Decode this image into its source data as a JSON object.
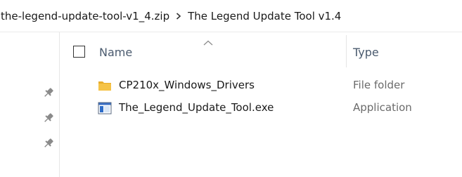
{
  "breadcrumb": {
    "items": [
      "the-legend-update-tool-v1_4.zip",
      "The Legend Update Tool v1.4"
    ],
    "separator_icon": "chevron-right-icon"
  },
  "nav_pane": {
    "pins": [
      "pin-icon",
      "pin-icon",
      "pin-icon"
    ]
  },
  "columns": {
    "name": "Name",
    "type": "Type",
    "sort_indicator": "sort-ascending-icon"
  },
  "files": [
    {
      "name": "CP210x_Windows_Drivers",
      "type": "File folder",
      "icon": "folder-icon"
    },
    {
      "name": "The_Legend_Update_Tool.exe",
      "type": "Application",
      "icon": "application-icon"
    }
  ],
  "colors": {
    "folder": "#f5c347",
    "header_text": "#4a5a6e",
    "type_text": "#6b6b6b"
  }
}
